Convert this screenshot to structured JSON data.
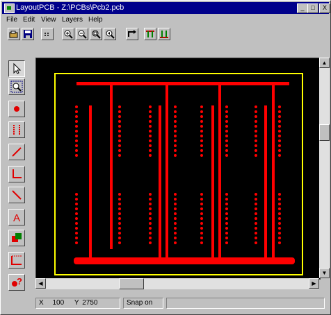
{
  "window": {
    "title": "LayoutPCB - Z:\\PCBs\\Pcb2.pcb",
    "minimize": "_",
    "maximize": "□",
    "close": "X"
  },
  "menu": [
    "File",
    "Edit",
    "View",
    "Layers",
    "Help"
  ],
  "toolbar": [
    "open-icon",
    "save-icon",
    "grid-icon",
    "zoom-in-icon",
    "zoom-out-icon",
    "zoom-fit-icon",
    "zoom-prev-icon",
    "route-icon",
    "pins-up-icon",
    "pins-down-icon"
  ],
  "tools": [
    "select-arrow-icon",
    "zoom-area-icon",
    "pad-icon",
    "component-icon",
    "line-icon",
    "corner-icon",
    "trace-icon",
    "text-icon",
    "copy-icon",
    "dimension-icon",
    "query-icon"
  ],
  "canvas": {
    "background": "#000000",
    "board_outline_color": "#ffff00",
    "trace_color": "#ff0000"
  },
  "status": {
    "x_label": "X",
    "x_value": "100",
    "y_label": "Y",
    "y_value": "2750",
    "mode": "Snap on"
  }
}
